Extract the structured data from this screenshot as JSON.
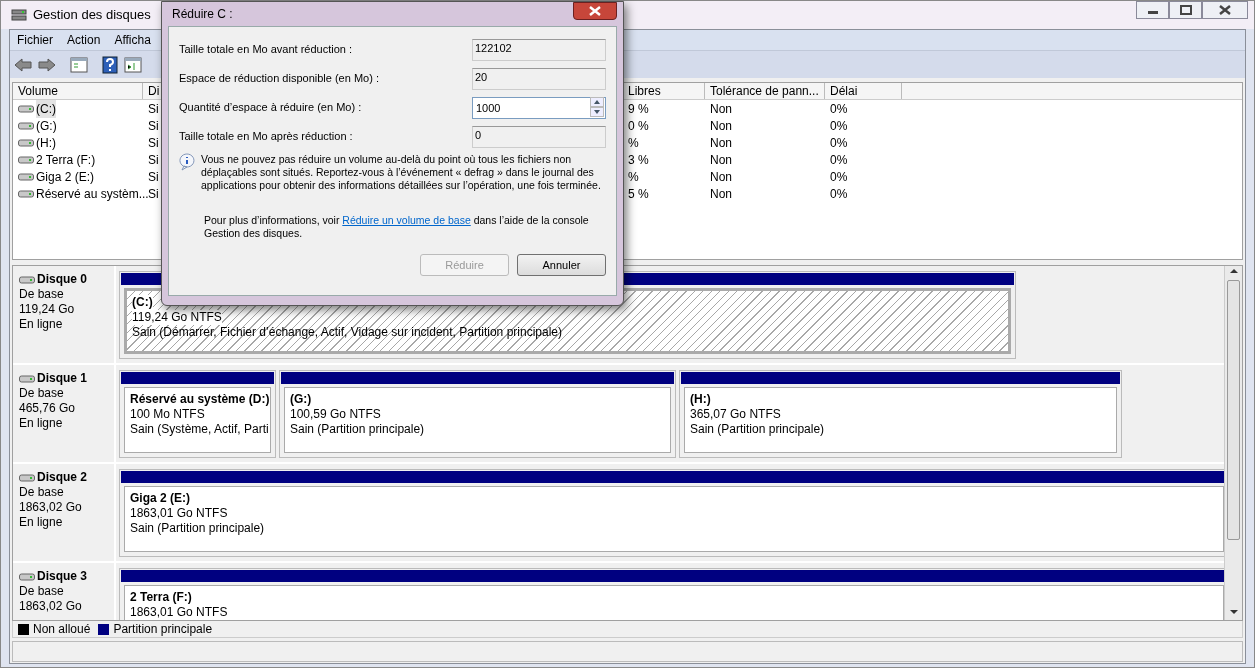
{
  "window": {
    "title": "Gestion des disques"
  },
  "menu": [
    {
      "label": "Fichier"
    },
    {
      "label": "Action"
    },
    {
      "label": "Afficha"
    }
  ],
  "table": {
    "columns": [
      {
        "label": "Volume"
      },
      {
        "label": "Di"
      },
      {
        "label": "Libres"
      },
      {
        "label": "Tolérance de pann..."
      },
      {
        "label": "Délai"
      }
    ],
    "rows": [
      {
        "selected": true,
        "cells": [
          "(C:)",
          "Si",
          "9 %",
          "Non",
          "0%"
        ]
      },
      {
        "selected": false,
        "cells": [
          "(G:)",
          "Si",
          "0 %",
          "Non",
          "0%"
        ]
      },
      {
        "selected": false,
        "cells": [
          "(H:)",
          "Si",
          "%",
          "Non",
          "0%"
        ]
      },
      {
        "selected": false,
        "cells": [
          "2 Terra (F:)",
          "Si",
          "3 %",
          "Non",
          "0%"
        ]
      },
      {
        "selected": false,
        "cells": [
          "Giga 2 (E:)",
          "Si",
          "%",
          "Non",
          "0%"
        ]
      },
      {
        "selected": false,
        "cells": [
          "Réservé au systèm...",
          "Si",
          "5 %",
          "Non",
          "0%"
        ]
      }
    ]
  },
  "disks": [
    {
      "name": "Disque 0",
      "type": "De base",
      "size": "119,24 Go",
      "status": "En ligne",
      "partitions": [
        {
          "name": "(C:)",
          "size": "119,24 Go NTFS",
          "health": "Sain (Démarrer, Fichier d’échange, Actif, Vidage sur incident, Partition principale)",
          "selected": true
        }
      ]
    },
    {
      "name": "Disque 1",
      "type": "De base",
      "size": "465,76 Go",
      "status": "En ligne",
      "partitions": [
        {
          "name": "Réservé au système  (D:)",
          "size": "100 Mo NTFS",
          "health": "Sain (Système, Actif, Parti",
          "selected": false
        },
        {
          "name": "(G:)",
          "size": "100,59 Go NTFS",
          "health": "Sain (Partition principale)",
          "selected": false
        },
        {
          "name": "(H:)",
          "size": "365,07 Go NTFS",
          "health": "Sain (Partition principale)",
          "selected": false
        }
      ]
    },
    {
      "name": "Disque 2",
      "type": "De base",
      "size": "1863,02 Go",
      "status": "En ligne",
      "partitions": [
        {
          "name": "Giga 2  (E:)",
          "size": "1863,01 Go NTFS",
          "health": "Sain (Partition principale)",
          "selected": false
        }
      ]
    },
    {
      "name": "Disque 3",
      "type": "De base",
      "size": "1863,02 Go",
      "partitions": [
        {
          "name": "2 Terra  (F:)",
          "size": "1863,01 Go NTFS",
          "selected": false
        }
      ]
    }
  ],
  "legend": [
    {
      "label": "Non alloué",
      "color": "#000000"
    },
    {
      "label": "Partition principale",
      "color": "#000080"
    }
  ],
  "dialog": {
    "title": "Réduire C :",
    "fields": [
      {
        "kind": "readonly",
        "label": "Taille totale en Mo avant réduction :",
        "value": "122102"
      },
      {
        "kind": "readonly",
        "label": "Espace de réduction disponible (en Mo) :",
        "value": "20"
      },
      {
        "kind": "spinner",
        "label": "Quantité d’espace à réduire (en Mo) :",
        "value": "1000"
      },
      {
        "kind": "readonly",
        "label": "Taille totale en Mo après réduction :",
        "value": "0"
      }
    ],
    "info": "Vous ne pouvez pas réduire un volume au-delà du point où tous les fichiers non déplaçables sont situés. Reportez-vous à l’événement « defrag » dans le journal des applications pour obtenir des informations détaillées sur l’opération, une fois terminée.",
    "more_before": "Pour plus d’informations, voir",
    "more_link": "Réduire un volume de base",
    "more_after": "dans l’aide de la console Gestion des disques.",
    "buttons": [
      {
        "label": "Réduire",
        "disabled": true
      },
      {
        "label": "Annuler",
        "disabled": false
      }
    ]
  }
}
